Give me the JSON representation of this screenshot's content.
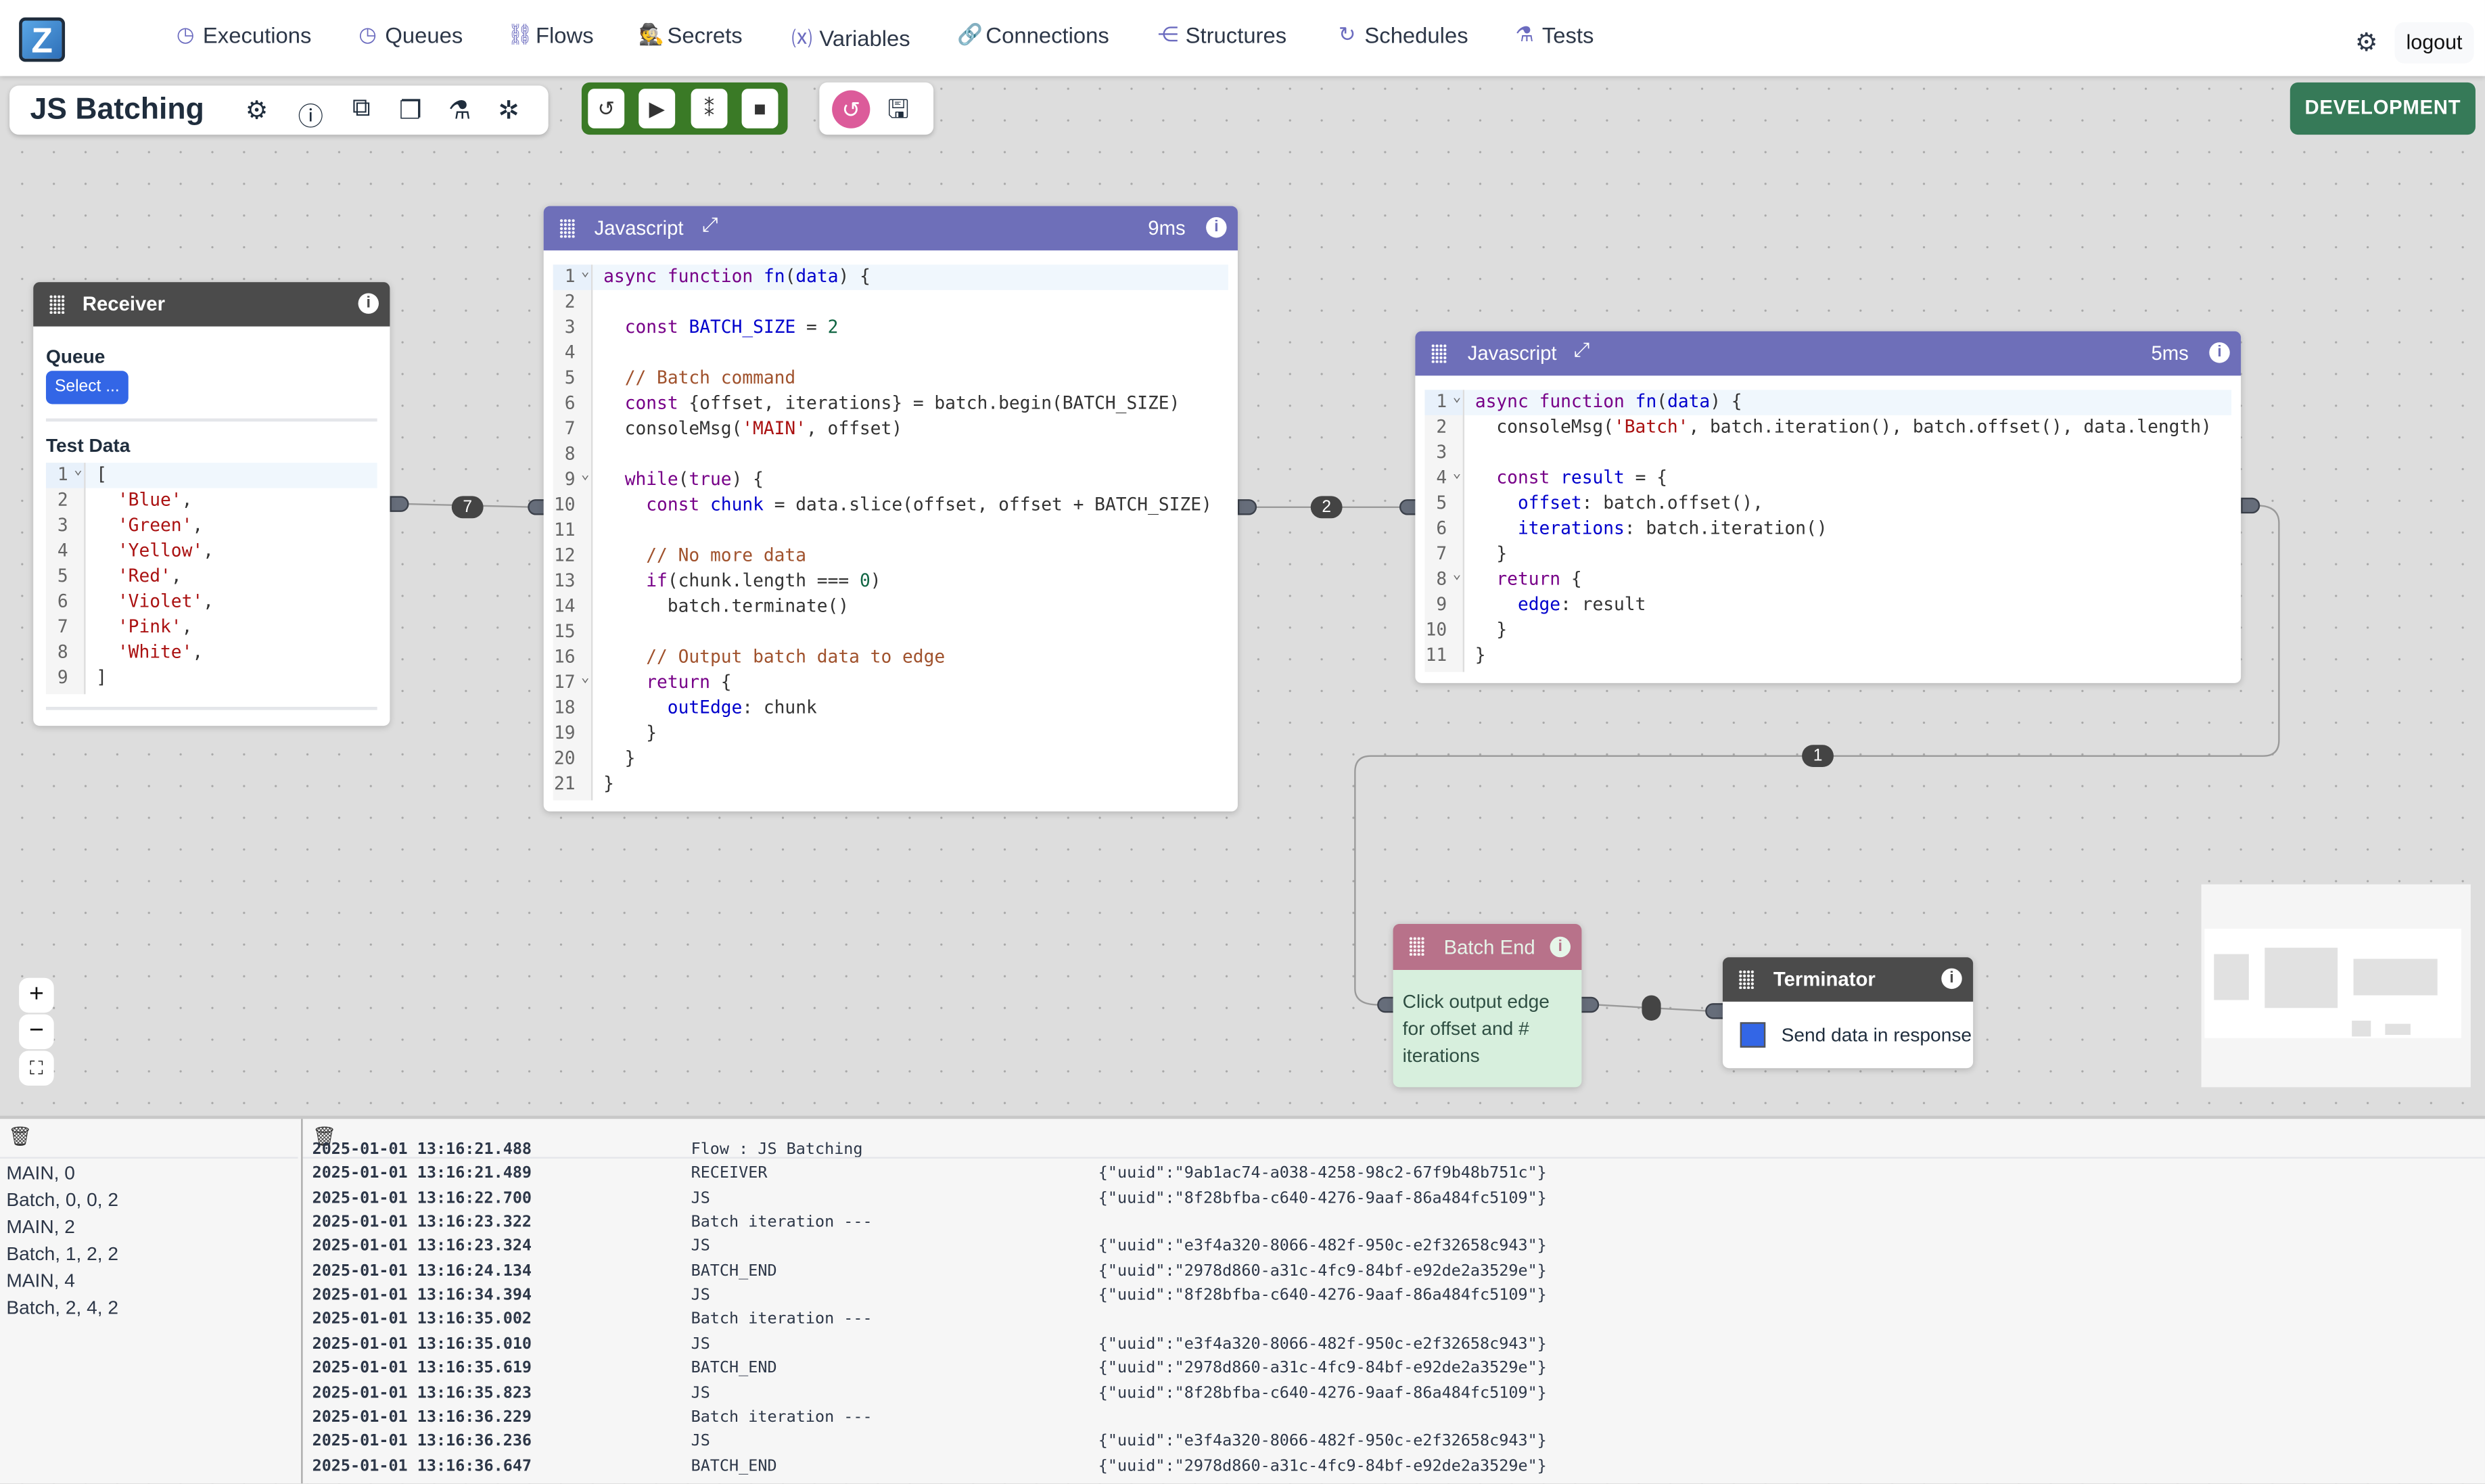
{
  "nav": {
    "logo": "Z",
    "items": [
      {
        "label": "Executions",
        "icon": "gauge-icon",
        "glyph": "◷"
      },
      {
        "label": "Queues",
        "icon": "gauge-icon",
        "glyph": "◷"
      },
      {
        "label": "Flows",
        "icon": "flow-icon",
        "glyph": "⛓"
      },
      {
        "label": "Secrets",
        "icon": "spy-icon",
        "glyph": "🕵"
      },
      {
        "label": "Variables",
        "icon": "variable-icon",
        "glyph": "⒳"
      },
      {
        "label": "Connections",
        "icon": "link-icon",
        "glyph": "🔗"
      },
      {
        "label": "Structures",
        "icon": "structure-icon",
        "glyph": "⋲"
      },
      {
        "label": "Schedules",
        "icon": "schedule-icon",
        "glyph": "↻"
      },
      {
        "label": "Tests",
        "icon": "flask-icon",
        "glyph": "⚗"
      }
    ],
    "settings_glyph": "⚙",
    "logout": "logout"
  },
  "toolbar": {
    "flow_name": "JS Batching",
    "tools": [
      "⚙",
      "ⓘ",
      "⧉",
      "❐",
      "⚗",
      "✲"
    ],
    "run_buttons": [
      "↺",
      "▶",
      "⁑",
      "■"
    ],
    "history_glyph": "↺",
    "save_glyph": "🖫",
    "environment": "DEVELOPMENT"
  },
  "colors": {
    "js_header": "#6e6fb9",
    "dark_header": "#4b4b4b",
    "batch_end_header": "#b8728a",
    "batch_end_body": "#d7efdd",
    "env": "#367a58",
    "run_group": "#3a7a26",
    "select_btn": "#3366e6"
  },
  "receiver": {
    "title": "Receiver",
    "queue_label": "Queue",
    "queue_select": "Select ...",
    "test_data_label": "Test Data",
    "lines": [
      "[",
      "  'Blue',",
      "  'Green',",
      "  'Yellow',",
      "  'Red',",
      "  'Violet',",
      "  'Pink',",
      "  'White',",
      "]"
    ]
  },
  "js1": {
    "title": "Javascript",
    "duration": "9ms",
    "lines": [
      "async function fn(data) {",
      "",
      "  const BATCH_SIZE = 2",
      "",
      "  // Batch command",
      "  const {offset, iterations} = batch.begin(BATCH_SIZE)",
      "  consoleMsg('MAIN', offset)",
      "",
      "  while(true) {",
      "    const chunk = data.slice(offset, offset + BATCH_SIZE)",
      "",
      "    // No more data",
      "    if(chunk.length === 0)",
      "      batch.terminate()",
      "",
      "    // Output batch data to edge",
      "    return {",
      "      outEdge: chunk",
      "    }",
      "  }",
      "}"
    ]
  },
  "js2": {
    "title": "Javascript",
    "duration": "5ms",
    "lines": [
      "async function fn(data) {",
      "  consoleMsg('Batch', batch.iteration(), batch.offset(), data.length)",
      "",
      "  const result = {",
      "    offset: batch.offset(),",
      "    iterations: batch.iteration()",
      "  }",
      "  return {",
      "    edge: result",
      "  }",
      "}"
    ]
  },
  "batch_end": {
    "title": "Batch End",
    "body": "Click output edge for offset and # iterations"
  },
  "terminator": {
    "title": "Terminator",
    "checkbox_label": "Send data in response",
    "checked": true
  },
  "edges": {
    "receiver_to_js1": "7",
    "js1_to_js2": "2",
    "js2_to_batch_end": "1"
  },
  "zoom_controls": [
    "+",
    "−",
    "⛶"
  ],
  "console": {
    "messages": [
      "MAIN, 0",
      "Batch, 0, 0, 2",
      "MAIN, 2",
      "Batch, 1, 2, 2",
      "MAIN, 4",
      "Batch, 2, 4, 2"
    ],
    "log": [
      {
        "ts": "2025-01-01 13:16:21.488",
        "event": "Flow : JS Batching",
        "json": ""
      },
      {
        "ts": "2025-01-01 13:16:21.489",
        "event": "RECEIVER",
        "json": "{\"uuid\":\"9ab1ac74-a038-4258-98c2-67f9b48b751c\"}"
      },
      {
        "ts": "2025-01-01 13:16:22.700",
        "event": "JS",
        "json": "{\"uuid\":\"8f28bfba-c640-4276-9aaf-86a484fc5109\"}"
      },
      {
        "ts": "2025-01-01 13:16:23.322",
        "event": "Batch iteration ---",
        "json": ""
      },
      {
        "ts": "2025-01-01 13:16:23.324",
        "event": "JS",
        "json": "{\"uuid\":\"e3f4a320-8066-482f-950c-e2f32658c943\"}"
      },
      {
        "ts": "2025-01-01 13:16:24.134",
        "event": "BATCH_END",
        "json": "{\"uuid\":\"2978d860-a31c-4fc9-84bf-e92de2a3529e\"}"
      },
      {
        "ts": "2025-01-01 13:16:34.394",
        "event": "JS",
        "json": "{\"uuid\":\"8f28bfba-c640-4276-9aaf-86a484fc5109\"}"
      },
      {
        "ts": "2025-01-01 13:16:35.002",
        "event": "Batch iteration ---",
        "json": ""
      },
      {
        "ts": "2025-01-01 13:16:35.010",
        "event": "JS",
        "json": "{\"uuid\":\"e3f4a320-8066-482f-950c-e2f32658c943\"}"
      },
      {
        "ts": "2025-01-01 13:16:35.619",
        "event": "BATCH_END",
        "json": "{\"uuid\":\"2978d860-a31c-4fc9-84bf-e92de2a3529e\"}"
      },
      {
        "ts": "2025-01-01 13:16:35.823",
        "event": "JS",
        "json": "{\"uuid\":\"8f28bfba-c640-4276-9aaf-86a484fc5109\"}"
      },
      {
        "ts": "2025-01-01 13:16:36.229",
        "event": "Batch iteration ---",
        "json": ""
      },
      {
        "ts": "2025-01-01 13:16:36.236",
        "event": "JS",
        "json": "{\"uuid\":\"e3f4a320-8066-482f-950c-e2f32658c943\"}"
      },
      {
        "ts": "2025-01-01 13:16:36.647",
        "event": "BATCH_END",
        "json": "{\"uuid\":\"2978d860-a31c-4fc9-84bf-e92de2a3529e\"}"
      }
    ]
  }
}
